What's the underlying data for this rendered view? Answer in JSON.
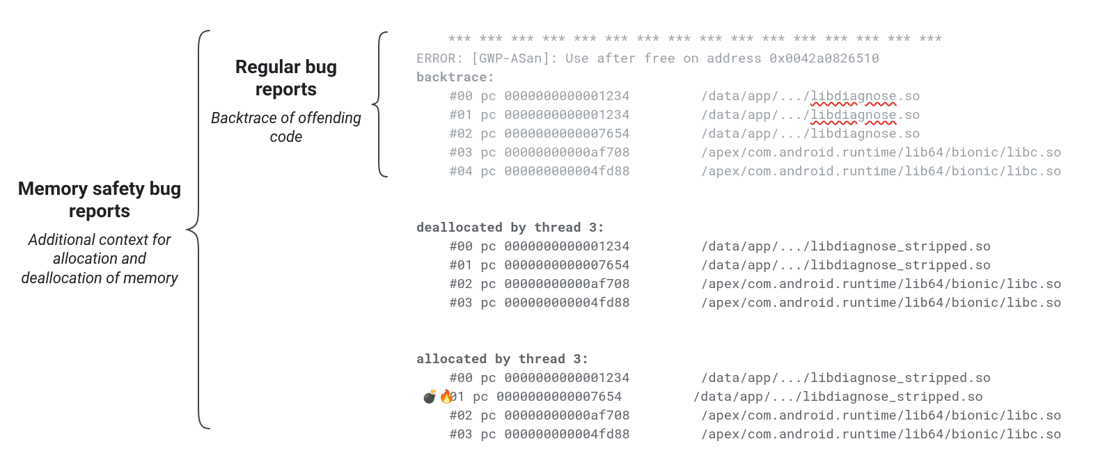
{
  "labels": {
    "left_title": "Memory safety bug reports",
    "left_sub": "Additional context for allocation and deallocation of memory",
    "mid_title": "Regular bug reports",
    "mid_sub": "Backtrace of offending code"
  },
  "separator": "*** *** *** *** *** *** *** *** *** *** *** *** *** *** *** ***",
  "error": "ERROR: [GWP-ASan]: Use after free on address 0x0042a0826510",
  "sections": {
    "backtrace": {
      "header": "backtrace:",
      "frames": [
        {
          "idx": "#00",
          "pc": "0000000000001234",
          "path": "/data/app/.../",
          "file": "libdiagnose",
          "ext": ".so",
          "squiggle": true
        },
        {
          "idx": "#01",
          "pc": "0000000000001234",
          "path": "/data/app/.../",
          "file": "libdiagnose",
          "ext": ".so",
          "squiggle": true
        },
        {
          "idx": "#02",
          "pc": "0000000000007654",
          "path": "/data/app/.../",
          "file": "libdiagnose",
          "ext": ".so",
          "squiggle": false
        },
        {
          "idx": "#03",
          "pc": "00000000000af708",
          "path": "/apex/com.android.runtime/lib64/bionic/",
          "file": "libc",
          "ext": ".so",
          "squiggle": false
        },
        {
          "idx": "#04",
          "pc": "000000000004fd88",
          "path": "/apex/com.android.runtime/lib64/bionic/",
          "file": "libc",
          "ext": ".so",
          "squiggle": false
        }
      ]
    },
    "dealloc": {
      "header": "deallocated by thread 3:",
      "frames": [
        {
          "idx": "#00",
          "pc": "0000000000001234",
          "path": "/data/app/.../",
          "file": "libdiagnose_stripped",
          "ext": ".so"
        },
        {
          "idx": "#01",
          "pc": "0000000000007654",
          "path": "/data/app/.../",
          "file": "libdiagnose_stripped",
          "ext": ".so"
        },
        {
          "idx": "#02",
          "pc": "00000000000af708",
          "path": "/apex/com.android.runtime/lib64/bionic/",
          "file": "libc",
          "ext": ".so"
        },
        {
          "idx": "#03",
          "pc": "000000000004fd88",
          "path": "/apex/com.android.runtime/lib64/bionic/",
          "file": "libc",
          "ext": ".so"
        }
      ]
    },
    "alloc": {
      "header": "allocated by thread 3:",
      "frames": [
        {
          "idx": "#00",
          "pc": "0000000000001234",
          "path": "/data/app/.../",
          "file": "libdiagnose_stripped",
          "ext": ".so"
        },
        {
          "idx": "#01",
          "pc": "0000000000007654",
          "path": "/data/app/.../",
          "file": "libdiagnose_stripped",
          "ext": ".so",
          "marker": true
        },
        {
          "idx": "#02",
          "pc": "00000000000af708",
          "path": "/apex/com.android.runtime/lib64/bionic/",
          "file": "libc",
          "ext": ".so"
        },
        {
          "idx": "#03",
          "pc": "000000000004fd88",
          "path": "/apex/com.android.runtime/lib64/bionic/",
          "file": "libc",
          "ext": ".so"
        }
      ]
    }
  },
  "emoji": "💣🔥"
}
